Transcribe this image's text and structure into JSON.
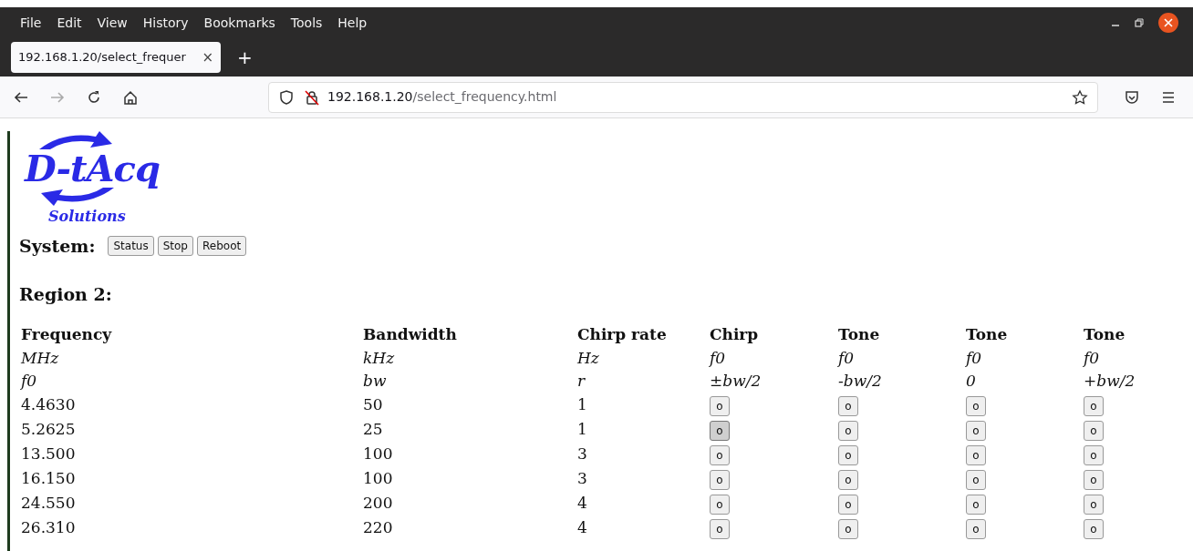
{
  "menu": [
    "File",
    "Edit",
    "View",
    "History",
    "Bookmarks",
    "Tools",
    "Help"
  ],
  "tab": {
    "title": "192.168.1.20/select_frequer",
    "close": "×",
    "selected": true
  },
  "new_tab": "+",
  "address": {
    "host": "192.168.1.20",
    "path": "/select_frequency.html"
  },
  "logo": {
    "top": "D-tAcq",
    "bottom": "Solutions"
  },
  "system": {
    "label": "System:",
    "buttons": [
      "Status",
      "Stop",
      "Reboot"
    ]
  },
  "region_heading": "Region 2:",
  "table": {
    "columns": [
      {
        "name": "Frequency",
        "unit": "MHz",
        "symbol": "f0"
      },
      {
        "name": "Bandwidth",
        "unit": "kHz",
        "symbol": "bw"
      },
      {
        "name": "Chirp rate",
        "unit": "Hz",
        "symbol": "r"
      },
      {
        "name": "Chirp",
        "unit": "f0",
        "symbol": "±bw/2"
      },
      {
        "name": "Tone",
        "unit": "f0",
        "symbol": "-bw/2"
      },
      {
        "name": "Tone",
        "unit": "f0",
        "symbol": "0"
      },
      {
        "name": "Tone",
        "unit": "f0",
        "symbol": "+bw/2"
      }
    ],
    "rows": [
      {
        "frequency": "4.4630",
        "bandwidth": "50",
        "chirp_rate": "1",
        "options": [
          {
            "label": "o",
            "selected": false
          },
          {
            "label": "o",
            "selected": false
          },
          {
            "label": "o",
            "selected": false
          },
          {
            "label": "o",
            "selected": false
          }
        ]
      },
      {
        "frequency": "5.2625",
        "bandwidth": "25",
        "chirp_rate": "1",
        "options": [
          {
            "label": "o",
            "selected": true
          },
          {
            "label": "o",
            "selected": false
          },
          {
            "label": "o",
            "selected": false
          },
          {
            "label": "o",
            "selected": false
          }
        ]
      },
      {
        "frequency": "13.500",
        "bandwidth": "100",
        "chirp_rate": "3",
        "options": [
          {
            "label": "o",
            "selected": false
          },
          {
            "label": "o",
            "selected": false
          },
          {
            "label": "o",
            "selected": false
          },
          {
            "label": "o",
            "selected": false
          }
        ]
      },
      {
        "frequency": "16.150",
        "bandwidth": "100",
        "chirp_rate": "3",
        "options": [
          {
            "label": "o",
            "selected": false
          },
          {
            "label": "o",
            "selected": false
          },
          {
            "label": "o",
            "selected": false
          },
          {
            "label": "o",
            "selected": false
          }
        ]
      },
      {
        "frequency": "24.550",
        "bandwidth": "200",
        "chirp_rate": "4",
        "options": [
          {
            "label": "o",
            "selected": false
          },
          {
            "label": "o",
            "selected": false
          },
          {
            "label": "o",
            "selected": false
          },
          {
            "label": "o",
            "selected": false
          }
        ]
      },
      {
        "frequency": "26.310",
        "bandwidth": "220",
        "chirp_rate": "4",
        "options": [
          {
            "label": "o",
            "selected": false
          },
          {
            "label": "o",
            "selected": false
          },
          {
            "label": "o",
            "selected": false
          },
          {
            "label": "o",
            "selected": false
          }
        ]
      }
    ]
  }
}
